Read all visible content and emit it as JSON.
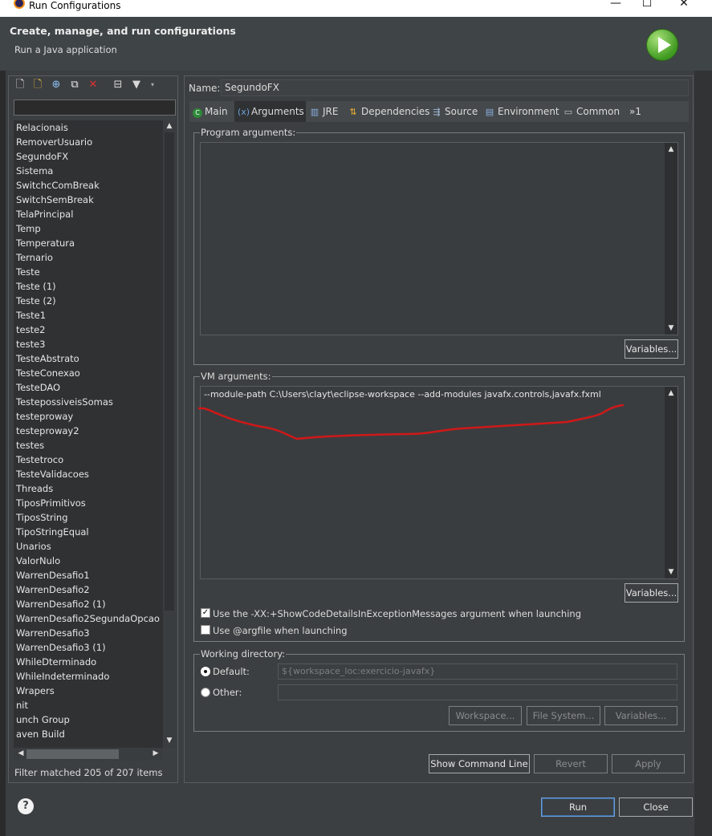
{
  "window": {
    "title": "Run Configurations",
    "minimize": "—",
    "maximize": "☐",
    "close": "✕"
  },
  "header": {
    "title": "Create, manage, and run configurations",
    "subtitle": "Run a Java application"
  },
  "left": {
    "filter_value": "",
    "items": [
      "Relacionais",
      "RemoverUsuario",
      "SegundoFX",
      "Sistema",
      "SwitchcComBreak",
      "SwitchSemBreak",
      "TelaPrincipal",
      "Temp",
      "Temperatura",
      "Ternario",
      "Teste",
      "Teste (1)",
      "Teste (2)",
      "Teste1",
      "teste2",
      "teste3",
      "TesteAbstrato",
      "TesteConexao",
      "TesteDAO",
      "TestepossiveisSomas",
      "testeproway",
      "testeproway2",
      "testes",
      "Testetroco",
      "TesteValidacoes",
      "Threads",
      "TiposPrimitivos",
      "TiposString",
      "TipoStringEqual",
      "Unarios",
      "ValorNulo",
      "WarrenDesafio1",
      "WarrenDesafio2",
      "WarrenDesafio2 (1)",
      "WarrenDesafio2SegundaOpcao",
      "WarrenDesafio3",
      "WarrenDesafio3 (1)",
      "WhileDterminado",
      "WhileIndeterminado",
      "Wrapers",
      "nit",
      "unch Group",
      "aven Build"
    ],
    "status": "Filter matched 205 of 207 items"
  },
  "right": {
    "name_label": "Name:",
    "name_value": "SegundoFX",
    "tabs": [
      {
        "label": "Main",
        "icon": "main-icon"
      },
      {
        "label": "Arguments",
        "icon": "arguments-icon"
      },
      {
        "label": "JRE",
        "icon": "jre-icon"
      },
      {
        "label": "Dependencies",
        "icon": "dependencies-icon"
      },
      {
        "label": "Source",
        "icon": "source-icon"
      },
      {
        "label": "Environment",
        "icon": "environment-icon"
      },
      {
        "label": "Common",
        "icon": "common-icon"
      },
      {
        "label": "»1",
        "icon": "more-tabs-icon"
      }
    ],
    "program_args_label": "Program arguments:",
    "program_args_value": "",
    "vm_args_label": "VM arguments:",
    "vm_args_value": "--module-path C:\\Users\\clayt\\eclipse-workspace --add-modules javafx.controls,javafx.fxml",
    "variables_label": "Variables...",
    "show_details_label": "Use the -XX:+ShowCodeDetailsInExceptionMessages argument when launching",
    "show_details_checked": true,
    "argfile_label": "Use @argfile when launching",
    "argfile_checked": false,
    "working_dir_label": "Working directory:",
    "default_label": "Default:",
    "default_value": "${workspace_loc:exercicio-javafx}",
    "other_label": "Other:",
    "other_value": "",
    "workspace_btn": "Workspace...",
    "filesystem_btn": "File System...",
    "wd_variables_btn": "Variables...",
    "show_cmd_btn": "Show Command Line",
    "revert_btn": "Revert",
    "apply_btn": "Apply"
  },
  "footer": {
    "run_btn": "Run",
    "close_btn": "Close",
    "help": "?"
  },
  "colors": {
    "annotation_red": "#d01818",
    "accent": "#6ea0d8"
  }
}
